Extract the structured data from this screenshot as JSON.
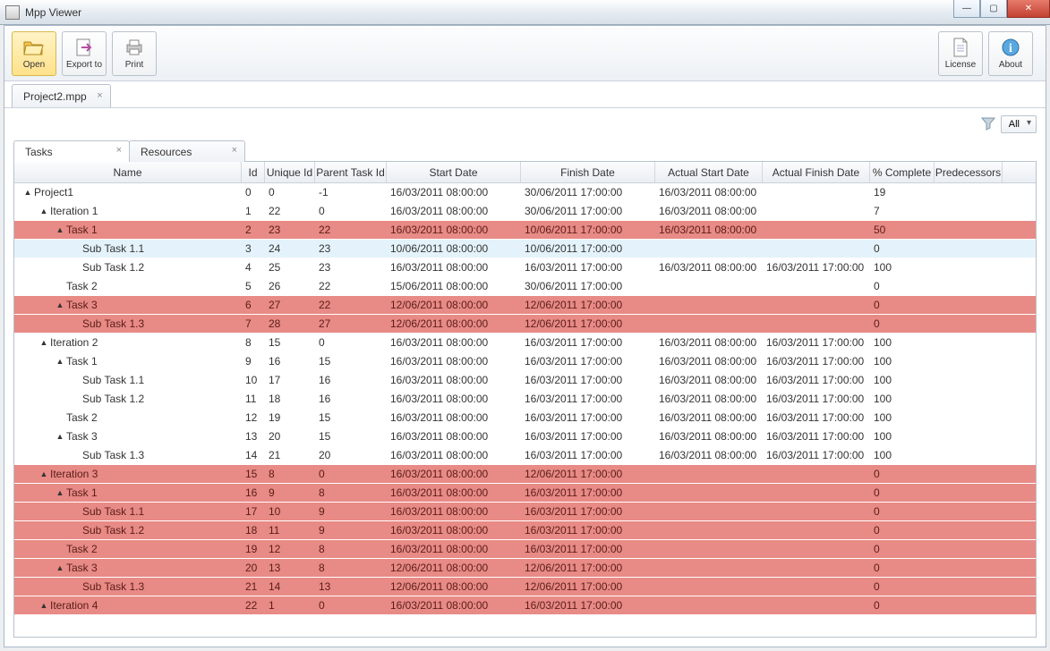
{
  "app": {
    "title": "Mpp Viewer"
  },
  "toolbar": {
    "open": "Open",
    "export": "Export to",
    "print": "Print",
    "license": "License",
    "about": "About"
  },
  "file_tab": {
    "label": "Project2.mpp"
  },
  "filter": {
    "label": "All"
  },
  "subtabs": {
    "tasks": "Tasks",
    "resources": "Resources"
  },
  "columns": {
    "name": "Name",
    "id": "Id",
    "uid": "Unique Id",
    "pid": "Parent Task Id",
    "start": "Start Date",
    "finish": "Finish Date",
    "astart": "Actual Start Date",
    "afinish": "Actual Finish Date",
    "pc": "% Complete",
    "pred": "Predecessors"
  },
  "rows": [
    {
      "indent": 0,
      "tw": "▲",
      "name": "Project1",
      "id": "0",
      "uid": "0",
      "pid": "-1",
      "sd": "16/03/2011 08:00:00",
      "fd": "30/06/2011 17:00:00",
      "asd": "16/03/2011 08:00:00",
      "afd": "",
      "pc": "19",
      "style": ""
    },
    {
      "indent": 1,
      "tw": "▲",
      "name": "Iteration 1",
      "id": "1",
      "uid": "22",
      "pid": "0",
      "sd": "16/03/2011 08:00:00",
      "fd": "30/06/2011 17:00:00",
      "asd": "16/03/2011 08:00:00",
      "afd": "",
      "pc": "7",
      "style": ""
    },
    {
      "indent": 2,
      "tw": "▲",
      "name": "Task 1",
      "id": "2",
      "uid": "23",
      "pid": "22",
      "sd": "16/03/2011 08:00:00",
      "fd": "10/06/2011 17:00:00",
      "asd": "16/03/2011 08:00:00",
      "afd": "",
      "pc": "50",
      "style": "red"
    },
    {
      "indent": 3,
      "tw": "",
      "name": "Sub Task 1.1",
      "id": "3",
      "uid": "24",
      "pid": "23",
      "sd": "10/06/2011 08:00:00",
      "fd": "10/06/2011 17:00:00",
      "asd": "",
      "afd": "",
      "pc": "0",
      "style": "sel"
    },
    {
      "indent": 3,
      "tw": "",
      "name": "Sub Task 1.2",
      "id": "4",
      "uid": "25",
      "pid": "23",
      "sd": "16/03/2011 08:00:00",
      "fd": "16/03/2011 17:00:00",
      "asd": "16/03/2011 08:00:00",
      "afd": "16/03/2011 17:00:00",
      "pc": "100",
      "style": ""
    },
    {
      "indent": 2,
      "tw": "",
      "name": "Task 2",
      "id": "5",
      "uid": "26",
      "pid": "22",
      "sd": "15/06/2011 08:00:00",
      "fd": "30/06/2011 17:00:00",
      "asd": "",
      "afd": "",
      "pc": "0",
      "style": ""
    },
    {
      "indent": 2,
      "tw": "▲",
      "name": "Task 3",
      "id": "6",
      "uid": "27",
      "pid": "22",
      "sd": "12/06/2011 08:00:00",
      "fd": "12/06/2011 17:00:00",
      "asd": "",
      "afd": "",
      "pc": "0",
      "style": "red"
    },
    {
      "indent": 3,
      "tw": "",
      "name": "Sub Task 1.3",
      "id": "7",
      "uid": "28",
      "pid": "27",
      "sd": "12/06/2011 08:00:00",
      "fd": "12/06/2011 17:00:00",
      "asd": "",
      "afd": "",
      "pc": "0",
      "style": "red"
    },
    {
      "indent": 1,
      "tw": "▲",
      "name": "Iteration 2",
      "id": "8",
      "uid": "15",
      "pid": "0",
      "sd": "16/03/2011 08:00:00",
      "fd": "16/03/2011 17:00:00",
      "asd": "16/03/2011 08:00:00",
      "afd": "16/03/2011 17:00:00",
      "pc": "100",
      "style": ""
    },
    {
      "indent": 2,
      "tw": "▲",
      "name": "Task 1",
      "id": "9",
      "uid": "16",
      "pid": "15",
      "sd": "16/03/2011 08:00:00",
      "fd": "16/03/2011 17:00:00",
      "asd": "16/03/2011 08:00:00",
      "afd": "16/03/2011 17:00:00",
      "pc": "100",
      "style": ""
    },
    {
      "indent": 3,
      "tw": "",
      "name": "Sub Task 1.1",
      "id": "10",
      "uid": "17",
      "pid": "16",
      "sd": "16/03/2011 08:00:00",
      "fd": "16/03/2011 17:00:00",
      "asd": "16/03/2011 08:00:00",
      "afd": "16/03/2011 17:00:00",
      "pc": "100",
      "style": ""
    },
    {
      "indent": 3,
      "tw": "",
      "name": "Sub Task 1.2",
      "id": "11",
      "uid": "18",
      "pid": "16",
      "sd": "16/03/2011 08:00:00",
      "fd": "16/03/2011 17:00:00",
      "asd": "16/03/2011 08:00:00",
      "afd": "16/03/2011 17:00:00",
      "pc": "100",
      "style": ""
    },
    {
      "indent": 2,
      "tw": "",
      "name": "Task 2",
      "id": "12",
      "uid": "19",
      "pid": "15",
      "sd": "16/03/2011 08:00:00",
      "fd": "16/03/2011 17:00:00",
      "asd": "16/03/2011 08:00:00",
      "afd": "16/03/2011 17:00:00",
      "pc": "100",
      "style": ""
    },
    {
      "indent": 2,
      "tw": "▲",
      "name": "Task 3",
      "id": "13",
      "uid": "20",
      "pid": "15",
      "sd": "16/03/2011 08:00:00",
      "fd": "16/03/2011 17:00:00",
      "asd": "16/03/2011 08:00:00",
      "afd": "16/03/2011 17:00:00",
      "pc": "100",
      "style": ""
    },
    {
      "indent": 3,
      "tw": "",
      "name": "Sub Task 1.3",
      "id": "14",
      "uid": "21",
      "pid": "20",
      "sd": "16/03/2011 08:00:00",
      "fd": "16/03/2011 17:00:00",
      "asd": "16/03/2011 08:00:00",
      "afd": "16/03/2011 17:00:00",
      "pc": "100",
      "style": ""
    },
    {
      "indent": 1,
      "tw": "▲",
      "name": "Iteration 3",
      "id": "15",
      "uid": "8",
      "pid": "0",
      "sd": "16/03/2011 08:00:00",
      "fd": "12/06/2011 17:00:00",
      "asd": "",
      "afd": "",
      "pc": "0",
      "style": "red"
    },
    {
      "indent": 2,
      "tw": "▲",
      "name": "Task 1",
      "id": "16",
      "uid": "9",
      "pid": "8",
      "sd": "16/03/2011 08:00:00",
      "fd": "16/03/2011 17:00:00",
      "asd": "",
      "afd": "",
      "pc": "0",
      "style": "red"
    },
    {
      "indent": 3,
      "tw": "",
      "name": "Sub Task 1.1",
      "id": "17",
      "uid": "10",
      "pid": "9",
      "sd": "16/03/2011 08:00:00",
      "fd": "16/03/2011 17:00:00",
      "asd": "",
      "afd": "",
      "pc": "0",
      "style": "red"
    },
    {
      "indent": 3,
      "tw": "",
      "name": "Sub Task 1.2",
      "id": "18",
      "uid": "11",
      "pid": "9",
      "sd": "16/03/2011 08:00:00",
      "fd": "16/03/2011 17:00:00",
      "asd": "",
      "afd": "",
      "pc": "0",
      "style": "red"
    },
    {
      "indent": 2,
      "tw": "",
      "name": "Task 2",
      "id": "19",
      "uid": "12",
      "pid": "8",
      "sd": "16/03/2011 08:00:00",
      "fd": "16/03/2011 17:00:00",
      "asd": "",
      "afd": "",
      "pc": "0",
      "style": "red"
    },
    {
      "indent": 2,
      "tw": "▲",
      "name": "Task 3",
      "id": "20",
      "uid": "13",
      "pid": "8",
      "sd": "12/06/2011 08:00:00",
      "fd": "12/06/2011 17:00:00",
      "asd": "",
      "afd": "",
      "pc": "0",
      "style": "red"
    },
    {
      "indent": 3,
      "tw": "",
      "name": "Sub Task 1.3",
      "id": "21",
      "uid": "14",
      "pid": "13",
      "sd": "12/06/2011 08:00:00",
      "fd": "12/06/2011 17:00:00",
      "asd": "",
      "afd": "",
      "pc": "0",
      "style": "red"
    },
    {
      "indent": 1,
      "tw": "▲",
      "name": "Iteration 4",
      "id": "22",
      "uid": "1",
      "pid": "0",
      "sd": "16/03/2011 08:00:00",
      "fd": "16/03/2011 17:00:00",
      "asd": "",
      "afd": "",
      "pc": "0",
      "style": "red"
    }
  ]
}
